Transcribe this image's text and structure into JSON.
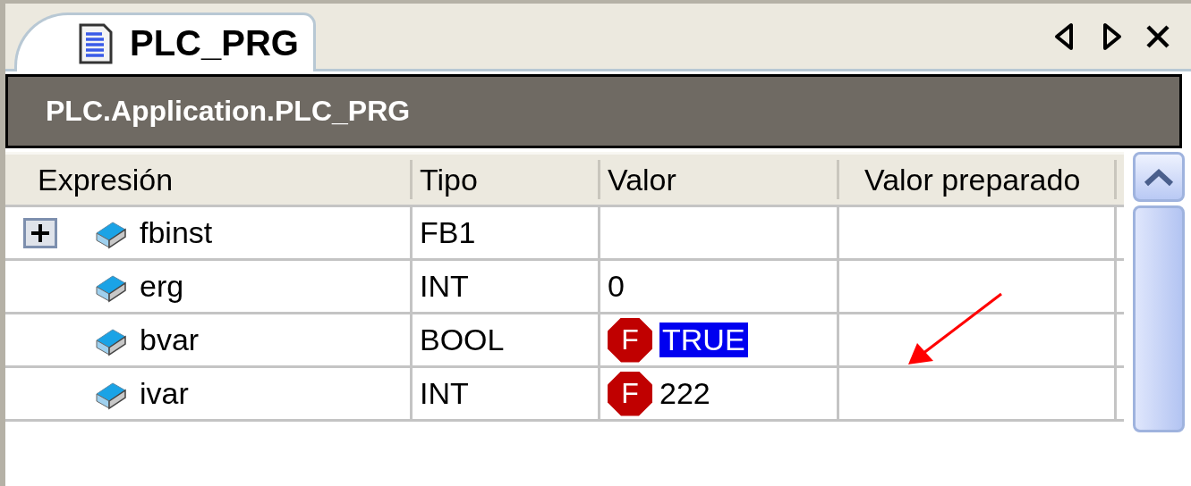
{
  "tab": {
    "title": "PLC_PRG",
    "selected": true
  },
  "path_bar": {
    "path": "PLC.Application.PLC_PRG"
  },
  "table": {
    "columns": [
      "Expresión",
      "Tipo",
      "Valor",
      "Valor preparado"
    ],
    "rows": [
      {
        "expression": "fbinst",
        "expandable": true,
        "expanded": false,
        "type": "FB1"
      },
      {
        "expression": "erg",
        "expandable": false,
        "type": "INT",
        "value": {
          "text": "0",
          "selected": false
        }
      },
      {
        "expression": "bvar",
        "expandable": false,
        "type": "BOOL",
        "value": {
          "force_mark": "F",
          "text": "TRUE",
          "selected": true
        }
      },
      {
        "expression": "ivar",
        "expandable": false,
        "type": "INT",
        "value": {
          "force_mark": "F",
          "text": "222",
          "selected": false
        }
      }
    ]
  }
}
